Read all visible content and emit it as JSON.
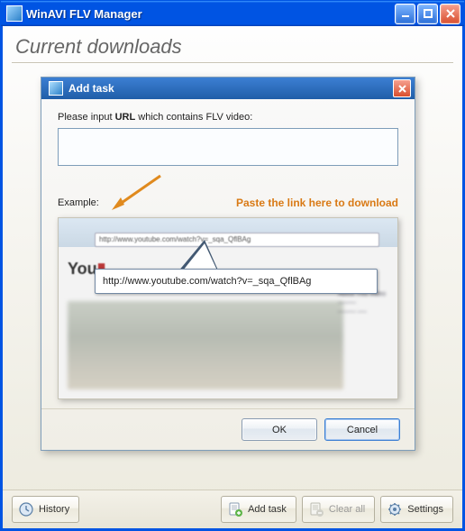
{
  "window": {
    "title": "WinAVI FLV Manager"
  },
  "page": {
    "heading": "Current downloads"
  },
  "dialog": {
    "title": "Add task",
    "instruction_pre": "Please input ",
    "instruction_bold": "URL",
    "instruction_post": " which contains FLV video:",
    "url_value": "",
    "example_label": "Example:",
    "hint": "Paste the link here to download",
    "example_addr": "http://www.youtube.com/watch?v=_sqa_QflBAg",
    "callout_url": "http://www.youtube.com/watch?v=_sqa_QflBAg",
    "ok_label": "OK",
    "cancel_label": "Cancel"
  },
  "toolbar": {
    "history": "History",
    "add_task": "Add task",
    "clear_all": "Clear all",
    "settings": "Settings"
  }
}
